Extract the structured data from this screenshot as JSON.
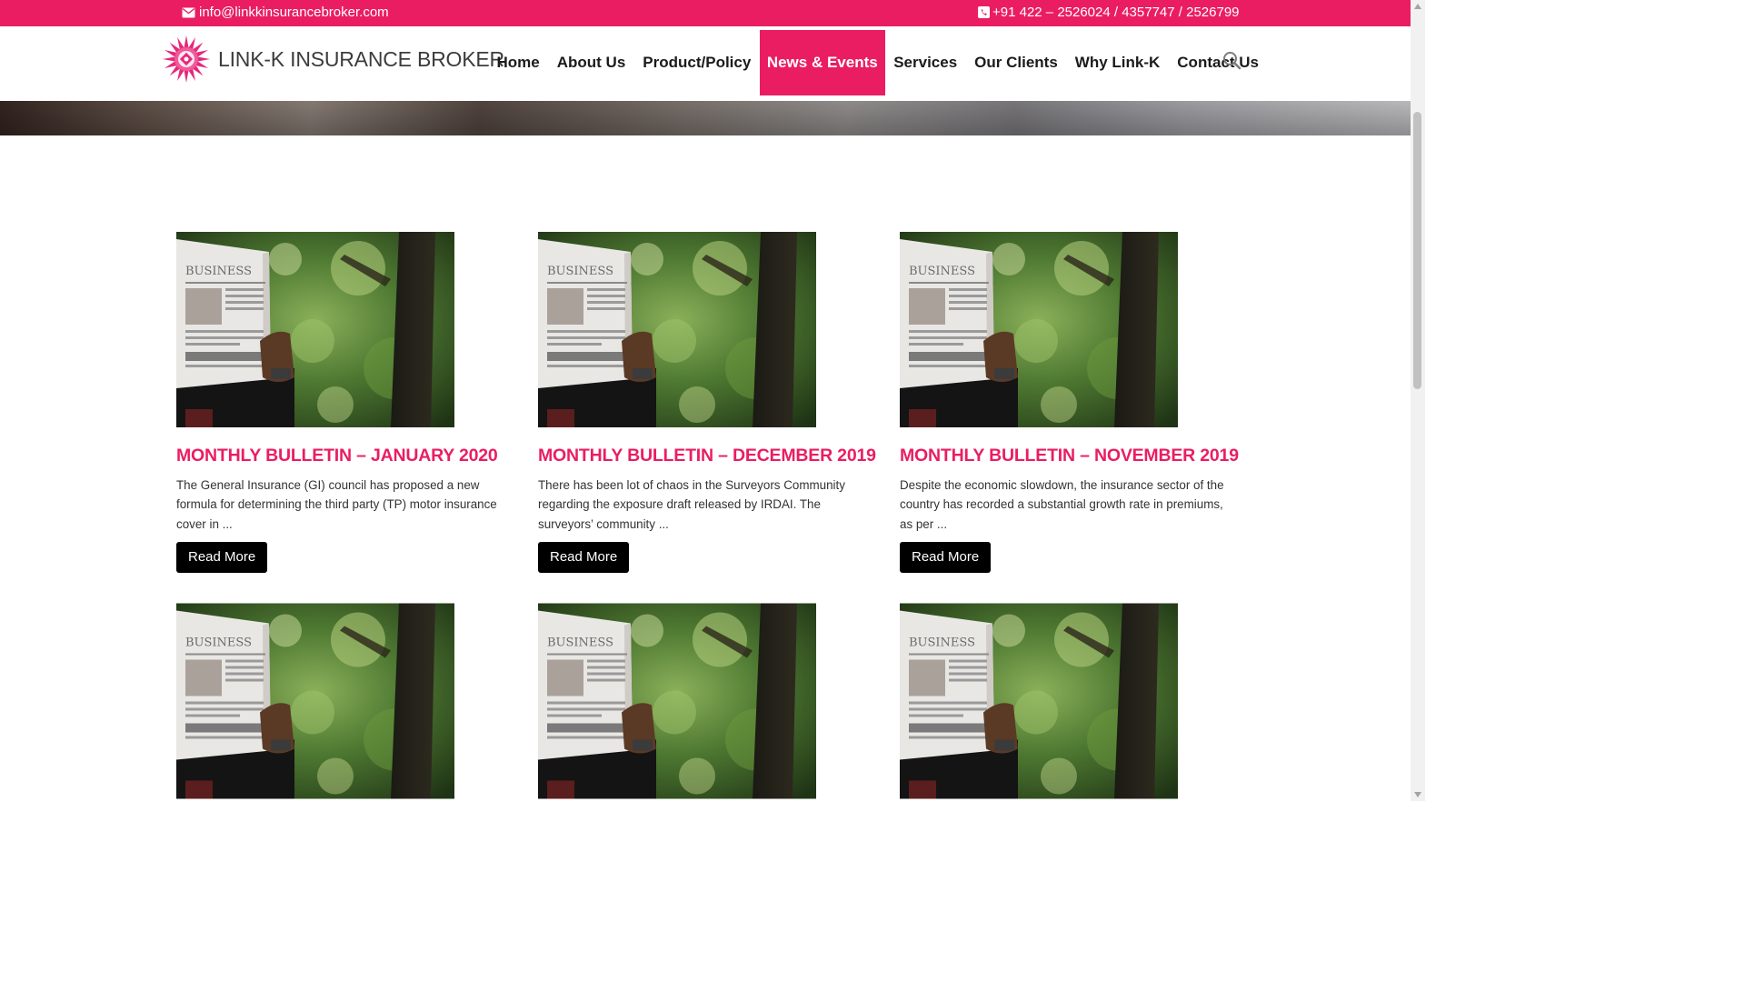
{
  "topbar": {
    "email": "info@linkkinsurancebroker.com",
    "phone": "+91 422 – 2526024 / 4357747 / 2526799",
    "email_icon": "envelope-icon",
    "phone_icon": "phone-icon"
  },
  "brand": {
    "name": "LINK-K INSURANCE BROKER",
    "accent_color": "#ea1d63"
  },
  "nav": {
    "items": [
      {
        "label": "Home"
      },
      {
        "label": "About Us"
      },
      {
        "label": "Product/Policy"
      },
      {
        "label": "News & Events",
        "active": true
      },
      {
        "label": "Services"
      },
      {
        "label": "Our Clients"
      },
      {
        "label": "Why Link-K"
      },
      {
        "label": "Contact Us"
      }
    ],
    "search_icon": "search-icon"
  },
  "posts": [
    {
      "title": "MONTHLY BULLETIN – JANUARY 2020",
      "excerpt": "The General Insurance (GI) council has proposed a new formula for determining the third party (TP) motor insurance cover in ...",
      "button": "Read More",
      "image_text": "BUSINESS"
    },
    {
      "title": "MONTHLY BULLETIN – DECEMBER 2019",
      "excerpt": "There has been lot of chaos in the Surveyors Community regarding the exposure draft released by IRDAI. The surveyors’ community ...",
      "button": "Read More",
      "image_text": "BUSINESS"
    },
    {
      "title": "MONTHLY BULLETIN – NOVEMBER 2019",
      "excerpt": "Despite the economic slowdown, the insurance sector of the country has recorded a substantial growth rate in premiums, as per ...",
      "button": "Read More",
      "image_text": "BUSINESS"
    },
    {
      "image_text": "BUSINESS"
    },
    {
      "image_text": "BUSINESS"
    },
    {
      "image_text": "BUSINESS"
    }
  ]
}
